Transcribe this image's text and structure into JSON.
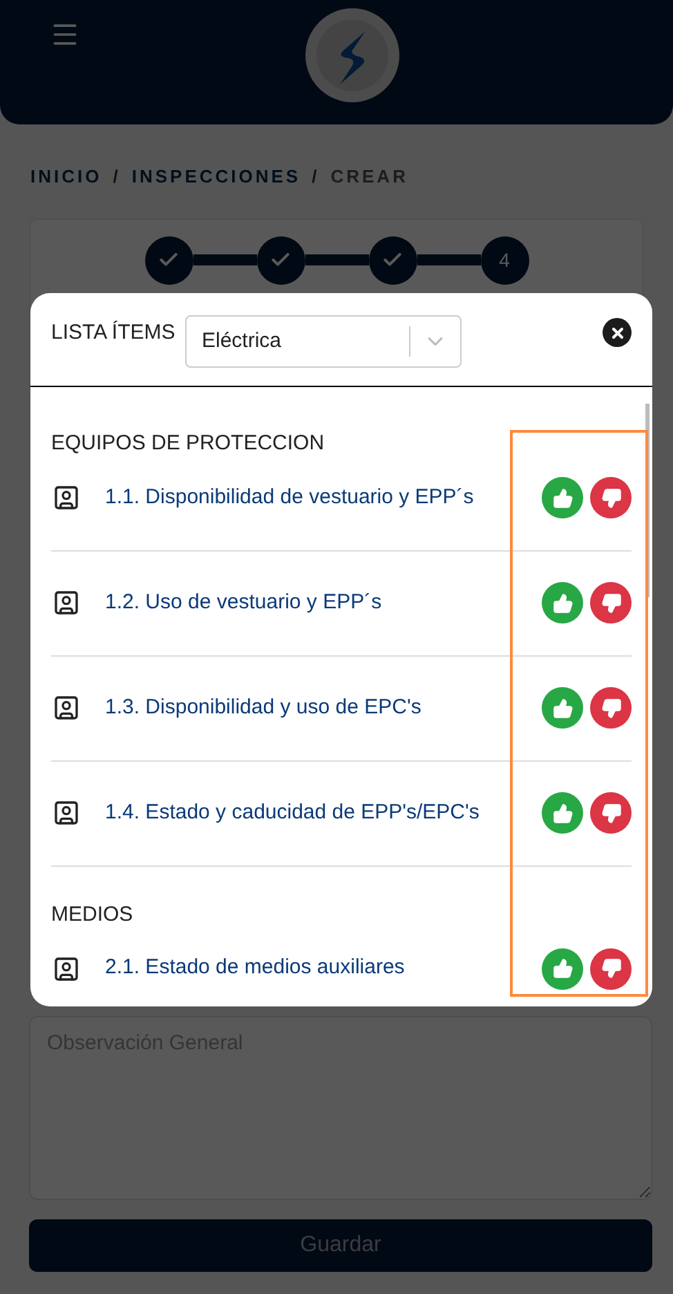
{
  "breadcrumb": [
    {
      "label": "INICIO",
      "current": false
    },
    {
      "label": "INSPECCIONES",
      "current": false
    },
    {
      "label": "CREAR",
      "current": true
    }
  ],
  "breadcrumb_separator": "/",
  "stepper": [
    {
      "done": true
    },
    {
      "done": true
    },
    {
      "done": true
    },
    {
      "done": false,
      "number": "4"
    }
  ],
  "observation": {
    "placeholder": "Observación General"
  },
  "save_button": "Guardar",
  "modal": {
    "title": "LISTA ÍTEMS",
    "select_value": "Eléctrica",
    "sections": [
      {
        "title": "EQUIPOS DE PROTECCION",
        "items": [
          {
            "label": "1.1. Disponibilidad de vestuario y EPP´s"
          },
          {
            "label": "1.2. Uso de vestuario y EPP´s"
          },
          {
            "label": "1.3. Disponibilidad y uso de EPC's"
          },
          {
            "label": "1.4. Estado y caducidad de EPP's/EPC's"
          }
        ]
      },
      {
        "title": "MEDIOS",
        "items": [
          {
            "label": "2.1. Estado de medios auxiliares"
          }
        ]
      }
    ]
  }
}
